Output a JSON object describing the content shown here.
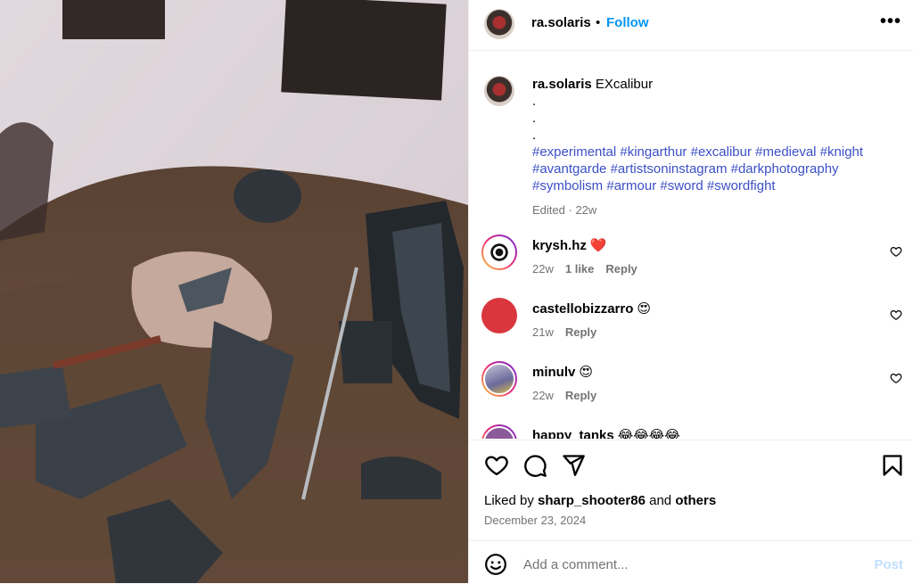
{
  "post": {
    "username": "ra.solaris",
    "follow_label": "Follow",
    "separator": "•",
    "more_label": "•••"
  },
  "caption": {
    "username": "ra.solaris",
    "title": "EXcalibur",
    "dots": [
      ".",
      ".",
      "."
    ],
    "hashtags": "#experimental #kingarthur #excalibur #medieval #knight #avantgarde #artistsoninstagram #darkphotography #symbolism #armour #sword #swordfight",
    "edited": "Edited",
    "time": "22w"
  },
  "comments": [
    {
      "user": "krysh.hz",
      "emoji": "❤️",
      "time": "22w",
      "likes": "1 like",
      "reply": "Reply"
    },
    {
      "user": "castellobizzarro",
      "emoji": "😍",
      "time": "21w",
      "likes": "",
      "reply": "Reply"
    },
    {
      "user": "minulv",
      "emoji": "😍",
      "time": "22w",
      "likes": "",
      "reply": "Reply"
    },
    {
      "user": "happy_tanks",
      "emoji": "😂😂😂😂",
      "time": "",
      "likes": "",
      "reply": ""
    }
  ],
  "actions": {
    "liked_prefix": "Liked by",
    "liked_user": "sharp_shooter86",
    "liked_and": "and",
    "liked_others": "others",
    "date": "December 23, 2024"
  },
  "add_comment": {
    "placeholder": "Add a comment...",
    "post_label": "Post"
  },
  "icons": [
    "heart-icon",
    "comment-icon",
    "share-icon",
    "bookmark-icon",
    "emoji-icon",
    "more-icon"
  ]
}
